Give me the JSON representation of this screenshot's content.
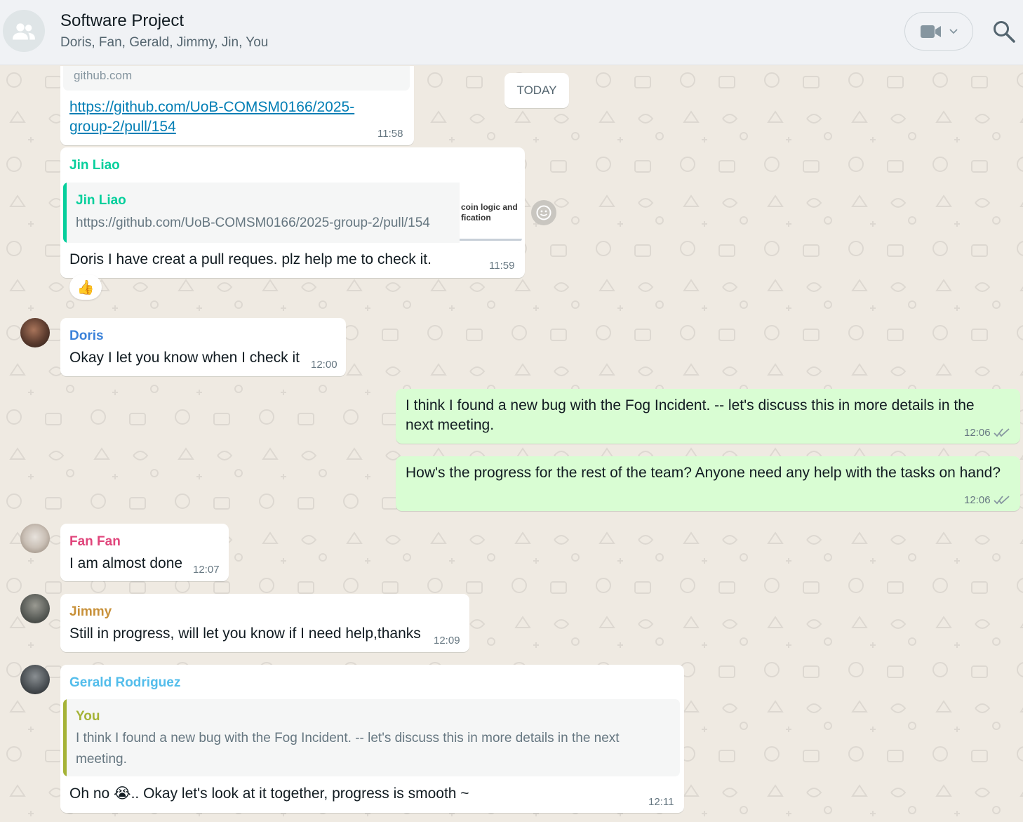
{
  "header": {
    "title": "Software Project",
    "participants": "Doris, Fan, Gerald, Jimmy, Jin, You"
  },
  "date_chip": "TODAY",
  "messages": {
    "m1": {
      "domain": "github.com",
      "link": "https://github.com/UoB-COMSM0166/2025-group-2/pull/154",
      "link_line1": "https://github.com/UoB-COMSM0166/2025-",
      "link_line2": "group-2/pull/154",
      "time": "11:58"
    },
    "m2": {
      "sender": "Jin Liao",
      "quote_sender": "Jin Liao",
      "quote_text": "https://github.com/UoB-COMSM0166/2025-group-2/pull/154",
      "thumb_line1": "coin logic and",
      "thumb_line2": "fication",
      "text": "Doris I have creat a pull reques. plz help me to check it.",
      "time": "11:59",
      "reaction": "👍"
    },
    "m3": {
      "sender": "Doris",
      "text": "Okay I let you know when I check it",
      "time": "12:00"
    },
    "m4": {
      "line1": "I think I found a new bug with the Fog Incident. -- let's discuss this in more details in the",
      "line2": "next meeting.",
      "time": "12:06"
    },
    "m5": {
      "text": "How's the progress for the rest of the team? Anyone need any help with the tasks on hand?",
      "time": "12:06"
    },
    "m6": {
      "sender": "Fan Fan",
      "text": "I am almost done",
      "time": "12:07"
    },
    "m7": {
      "sender": "Jimmy",
      "text": "Still in progress, will let you know if I need help,thanks",
      "time": "12:09"
    },
    "m8": {
      "sender": "Gerald Rodriguez",
      "quote_sender": "You",
      "quote_line1": "I think I found a new bug with the Fog Incident. -- let's discuss this in more details in the next",
      "quote_line2": "meeting.",
      "text": "Oh no 😭.. Okay let's look at it together, progress is smooth ~",
      "time": "12:11"
    }
  },
  "colors": {
    "jin": "#06cf9c",
    "doris": "#3b82d9",
    "fan": "#e0457b",
    "jimmy": "#c8913a",
    "gerald": "#53bdeb",
    "you": "#a5b337"
  }
}
